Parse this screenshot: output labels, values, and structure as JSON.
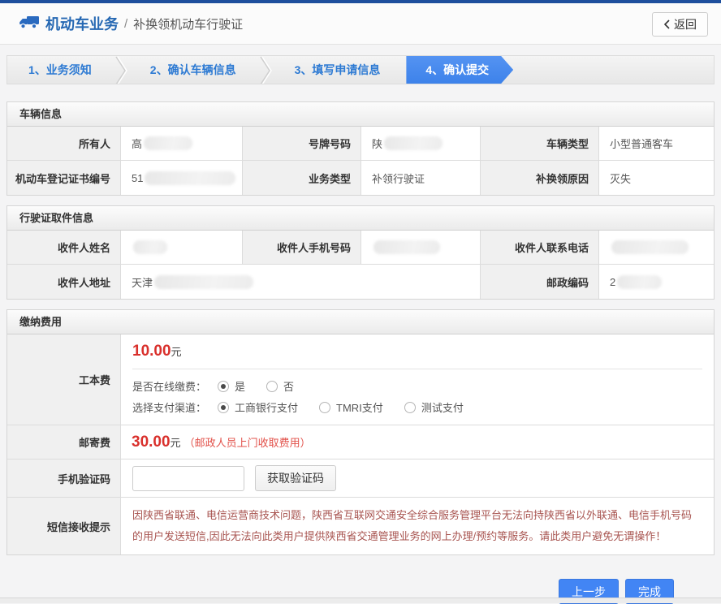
{
  "header": {
    "title": "机动车业务",
    "divider": "/",
    "subtitle": "补换领机动车行驶证",
    "back_label": "返回"
  },
  "steps": [
    {
      "label": "1、业务须知"
    },
    {
      "label": "2、确认车辆信息"
    },
    {
      "label": "3、填写申请信息"
    },
    {
      "label": "4、确认提交"
    }
  ],
  "vehicle_info": {
    "title": "车辆信息",
    "fields": {
      "owner": {
        "label": "所有人",
        "value": "高"
      },
      "plate": {
        "label": "号牌号码",
        "value": "陕"
      },
      "vehicle_type": {
        "label": "车辆类型",
        "value": "小型普通客车"
      },
      "reg_cert_no": {
        "label": "机动车登记证书编号",
        "value": "51"
      },
      "business_type": {
        "label": "业务类型",
        "value": "补领行驶证"
      },
      "reason": {
        "label": "补换领原因",
        "value": "灭失"
      }
    }
  },
  "pickup_info": {
    "title": "行驶证取件信息",
    "fields": {
      "recipient_name": {
        "label": "收件人姓名",
        "value": ""
      },
      "recipient_mobile": {
        "label": "收件人手机号码",
        "value": ""
      },
      "recipient_phone": {
        "label": "收件人联系电话",
        "value": ""
      },
      "recipient_address": {
        "label": "收件人地址",
        "value": "天津"
      },
      "postal_code": {
        "label": "邮政编码",
        "value": "2"
      }
    }
  },
  "payment": {
    "title": "缴纳费用",
    "cost_fee": {
      "label": "工本费",
      "amount": "10.00",
      "unit": "元"
    },
    "online_pay": {
      "caption": "是否在线缴费：",
      "options": [
        {
          "label": "是",
          "selected": true
        },
        {
          "label": "否",
          "selected": false
        }
      ]
    },
    "pay_channel": {
      "caption": "选择支付渠道：",
      "options": [
        {
          "label": "工商银行支付",
          "selected": true
        },
        {
          "label": "TMRI支付",
          "selected": false
        },
        {
          "label": "测试支付",
          "selected": false
        }
      ]
    },
    "postage_fee": {
      "label": "邮寄费",
      "amount": "30.00",
      "unit": "元",
      "note": "（邮政人员上门收取费用）"
    },
    "sms_code": {
      "label": "手机验证码",
      "input_value": "",
      "button_label": "获取验证码"
    },
    "sms_notice": {
      "label": "短信接收提示",
      "text": "因陕西省联通、电信运营商技术问题，陕西省互联网交通安全综合服务管理平台无法向持陕西省以外联通、电信手机号码的用户发送短信,因此无法向此类用户提供陕西省交通管理业务的网上办理/预约等服务。请此类用户避免无谓操作！"
    }
  },
  "footer": {
    "prev_label": "上一步",
    "finish_label": "完成"
  },
  "colors": {
    "navy_top": "#1e4f9d",
    "accent_blue": "#4285f4",
    "step_text_blue": "#2d7ad3",
    "fee_red": "#d9302c",
    "notice_red": "#a85450"
  }
}
